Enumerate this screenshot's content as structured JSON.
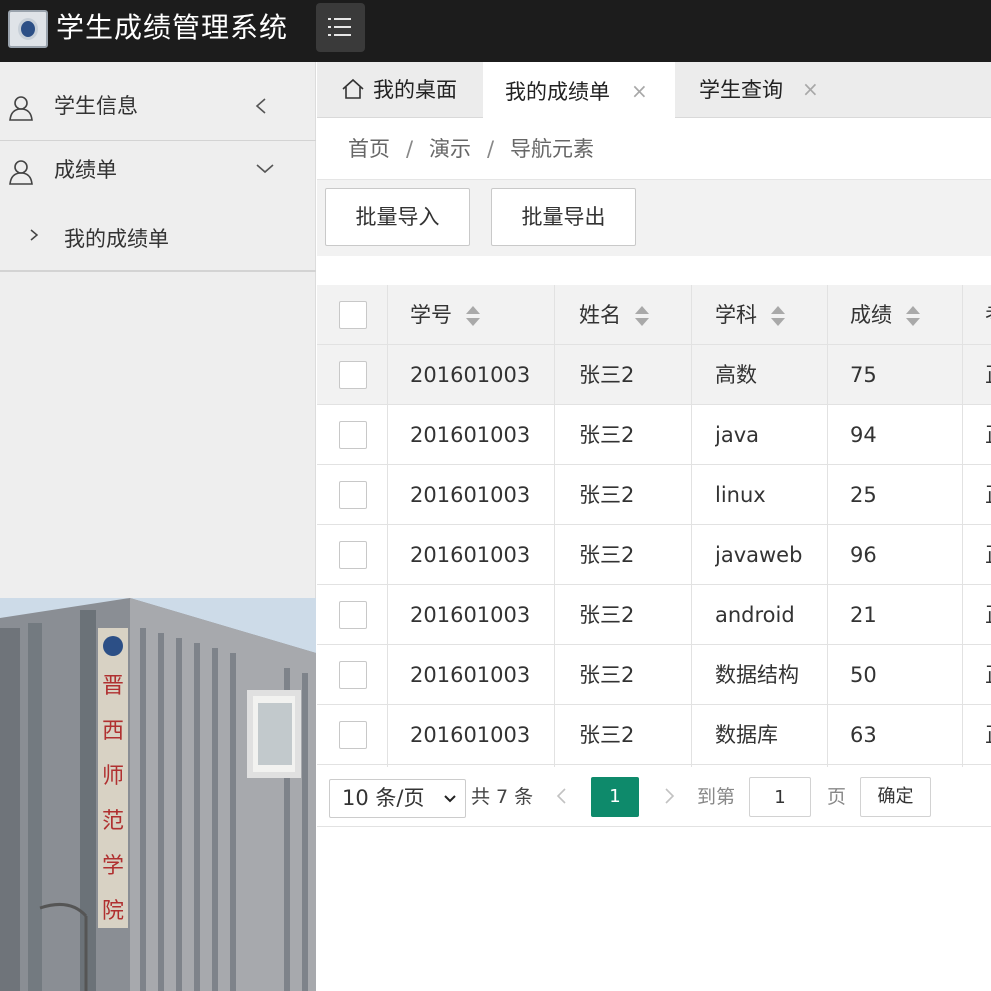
{
  "app": {
    "title": "学生成绩管理系统"
  },
  "sidebar": {
    "items": [
      {
        "label": "学生信息",
        "icon": "user-icon",
        "expanded": false
      },
      {
        "label": "成绩单",
        "icon": "user-icon",
        "expanded": true
      }
    ],
    "sub_items": [
      {
        "label": "我的成绩单"
      }
    ]
  },
  "tabs": [
    {
      "label": "我的桌面",
      "icon": "home-icon",
      "closable": false,
      "active": false
    },
    {
      "label": "我的成绩单",
      "closable": true,
      "active": true
    },
    {
      "label": "学生查询",
      "closable": true,
      "active": false
    }
  ],
  "breadcrumb": {
    "items": [
      "首页",
      "演示",
      "导航元素"
    ],
    "separator": "/"
  },
  "toolbar": {
    "import_label": "批量导入",
    "export_label": "批量导出"
  },
  "table": {
    "columns": [
      "学号",
      "姓名",
      "学科",
      "成绩",
      "考"
    ],
    "rows": [
      [
        "201601003",
        "张三2",
        "高数",
        "75",
        "正"
      ],
      [
        "201601003",
        "张三2",
        "java",
        "94",
        "正"
      ],
      [
        "201601003",
        "张三2",
        "linux",
        "25",
        "正"
      ],
      [
        "201601003",
        "张三2",
        "javaweb",
        "96",
        "正"
      ],
      [
        "201601003",
        "张三2",
        "android",
        "21",
        "正"
      ],
      [
        "201601003",
        "张三2",
        "数据结构",
        "50",
        "正"
      ],
      [
        "201601003",
        "张三2",
        "数据库",
        "63",
        "正"
      ]
    ]
  },
  "pager": {
    "page_size_label": "10 条/页",
    "total_label": "共 7 条",
    "current_page": "1",
    "goto_prefix": "到第",
    "goto_value": "1",
    "goto_suffix": "页",
    "confirm_label": "确定"
  },
  "colors": {
    "accent": "#0e8a6b",
    "header_bg": "#1c1c1c",
    "sidebar_bg": "#eeeeee"
  }
}
